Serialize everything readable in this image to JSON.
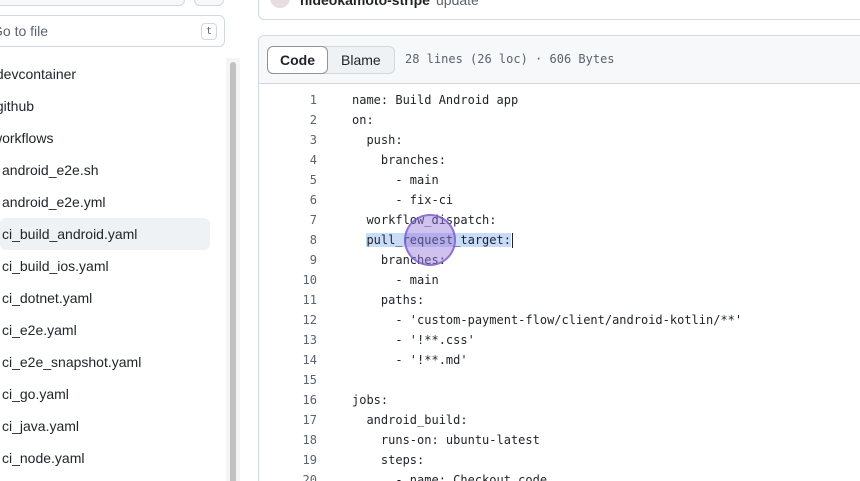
{
  "sidebar": {
    "goto_placeholder": "Go to file",
    "goto_shortcut": "t",
    "items": [
      {
        "label": ".devcontainer",
        "indent": 0
      },
      {
        "label": ".github",
        "indent": 0
      },
      {
        "label": "workflows",
        "indent": 0
      },
      {
        "label": "android_e2e.sh",
        "indent": 1
      },
      {
        "label": "android_e2e.yml",
        "indent": 1
      },
      {
        "label": "ci_build_android.yaml",
        "indent": 1,
        "active": true
      },
      {
        "label": "ci_build_ios.yaml",
        "indent": 1
      },
      {
        "label": "ci_dotnet.yaml",
        "indent": 1
      },
      {
        "label": "ci_e2e.yaml",
        "indent": 1
      },
      {
        "label": "ci_e2e_snapshot.yaml",
        "indent": 1
      },
      {
        "label": "ci_go.yaml",
        "indent": 1
      },
      {
        "label": "ci_java.yaml",
        "indent": 1
      },
      {
        "label": "ci_node.yaml",
        "indent": 1
      }
    ]
  },
  "commit": {
    "author": "hideokamoto-stripe",
    "message": "update"
  },
  "file": {
    "tabs": [
      "Code",
      "Blame"
    ],
    "active_tab": "Code",
    "meta": "28 lines (26 loc) · 606 Bytes",
    "lines": [
      {
        "n": "1",
        "text": "name: Build Android app"
      },
      {
        "n": "2",
        "text": "on:"
      },
      {
        "n": "3",
        "text": "  push:"
      },
      {
        "n": "4",
        "text": "    branches:"
      },
      {
        "n": "5",
        "text": "      - main"
      },
      {
        "n": "6",
        "text": "      - fix-ci"
      },
      {
        "n": "7",
        "text": "  workflow_dispatch:"
      },
      {
        "n": "8",
        "text": "  pull_request_target:",
        "selected": true
      },
      {
        "n": "9",
        "text": "    branches:"
      },
      {
        "n": "10",
        "text": "      - main"
      },
      {
        "n": "11",
        "text": "    paths:"
      },
      {
        "n": "12",
        "text": "      - 'custom-payment-flow/client/android-kotlin/**'"
      },
      {
        "n": "13",
        "text": "      - '!**.css'"
      },
      {
        "n": "14",
        "text": "      - '!**.md'"
      },
      {
        "n": "15",
        "text": ""
      },
      {
        "n": "16",
        "text": "jobs:"
      },
      {
        "n": "17",
        "text": "  android_build:"
      },
      {
        "n": "18",
        "text": "    runs-on: ubuntu-latest"
      },
      {
        "n": "19",
        "text": "    steps:"
      },
      {
        "n": "20",
        "text": "      - name: Checkout code"
      }
    ]
  }
}
